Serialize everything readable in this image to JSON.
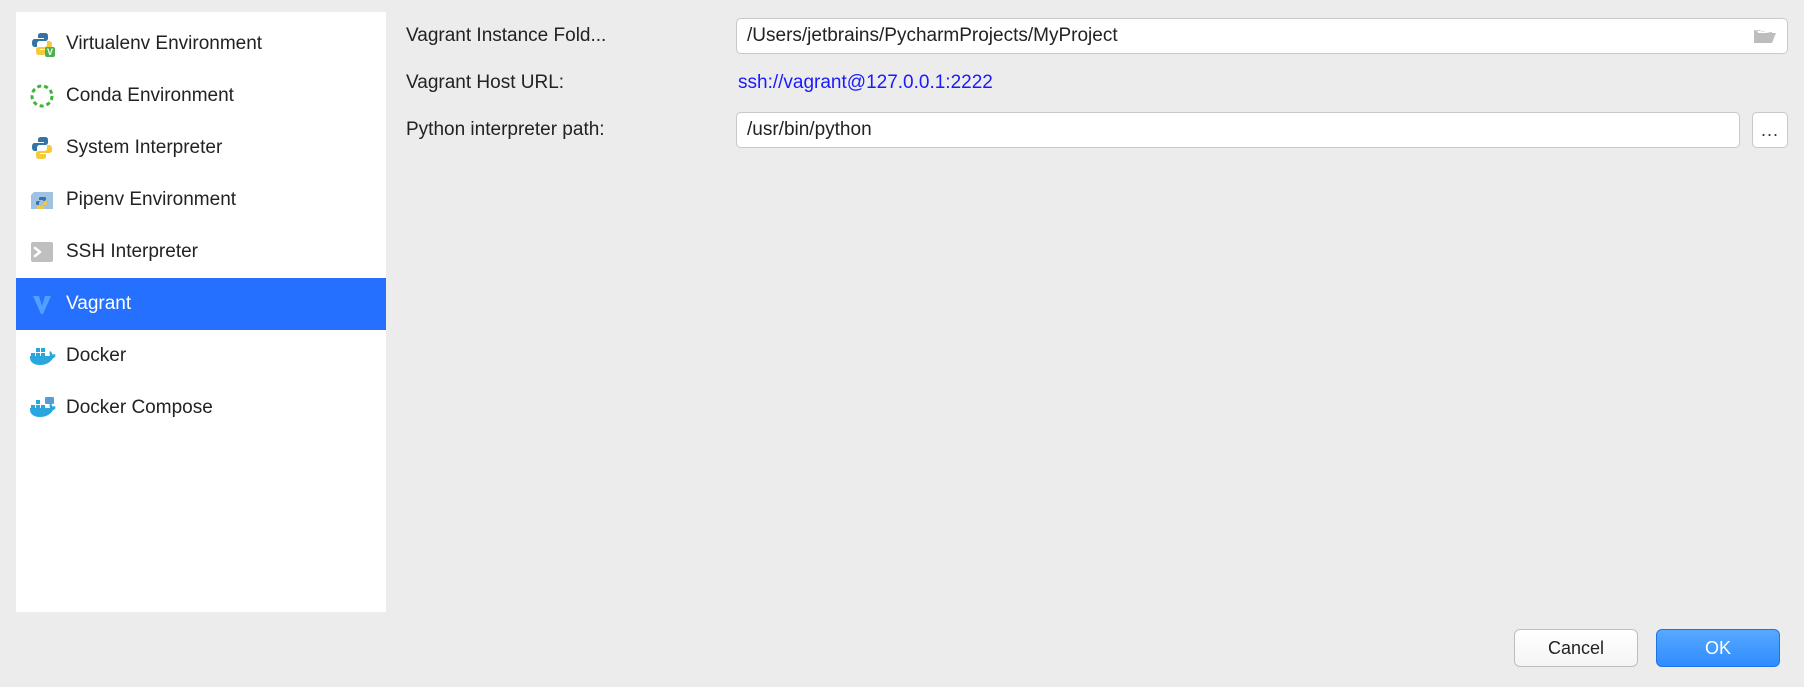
{
  "sidebar": {
    "items": [
      {
        "label": "Virtualenv Environment",
        "icon": "python-venv-icon"
      },
      {
        "label": "Conda Environment",
        "icon": "conda-icon"
      },
      {
        "label": "System Interpreter",
        "icon": "python-icon"
      },
      {
        "label": "Pipenv Environment",
        "icon": "pipenv-icon"
      },
      {
        "label": "SSH Interpreter",
        "icon": "terminal-icon"
      },
      {
        "label": "Vagrant",
        "icon": "vagrant-icon"
      },
      {
        "label": "Docker",
        "icon": "docker-icon"
      },
      {
        "label": "Docker Compose",
        "icon": "docker-compose-icon"
      }
    ],
    "selected_index": 5
  },
  "form": {
    "instance_folder_label": "Vagrant Instance Fold...",
    "instance_folder_value": "/Users/jetbrains/PycharmProjects/MyProject",
    "host_url_label": "Vagrant Host URL:",
    "host_url_value": "ssh://vagrant@127.0.0.1:2222",
    "interpreter_path_label": "Python interpreter path:",
    "interpreter_path_value": "/usr/bin/python",
    "ellipsis": "..."
  },
  "footer": {
    "cancel": "Cancel",
    "ok": "OK"
  }
}
